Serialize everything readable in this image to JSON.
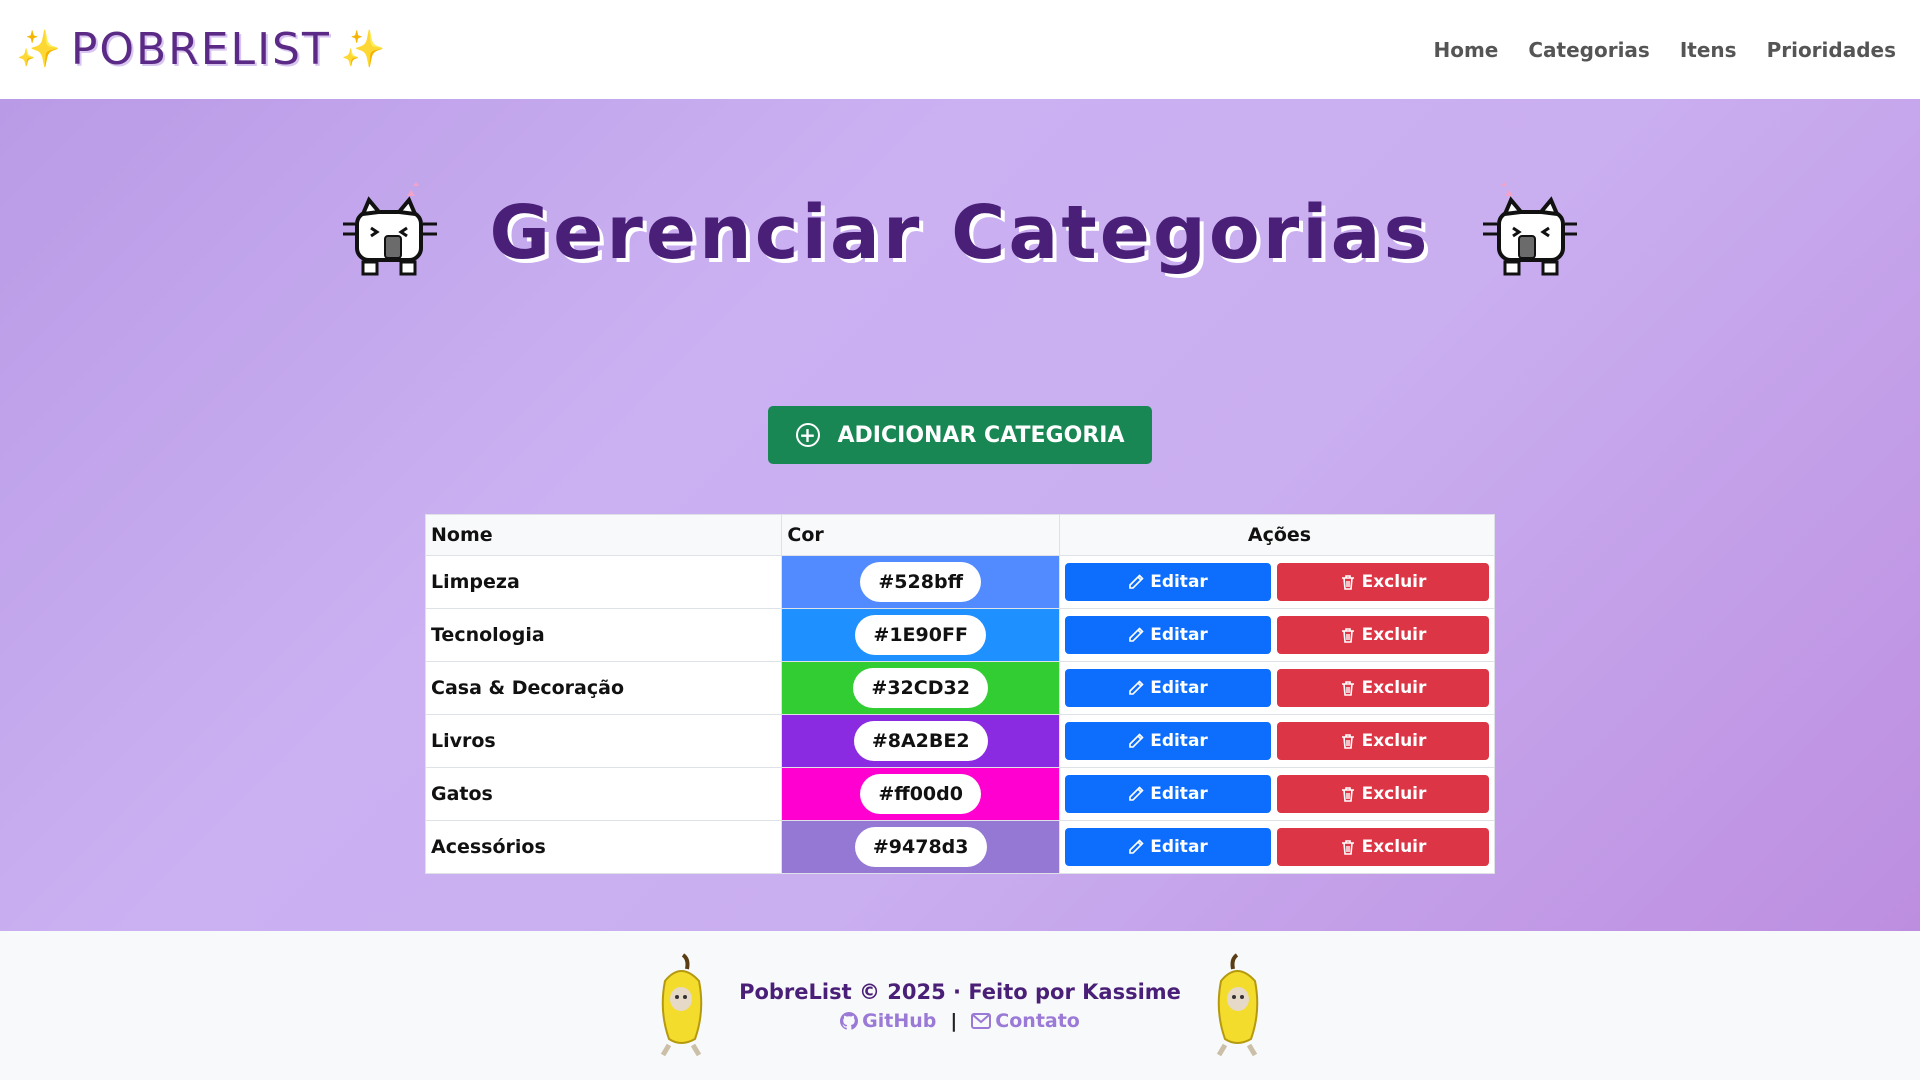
{
  "navbar": {
    "brand": "POBRELIST",
    "sparkle": "✨",
    "links": [
      "Home",
      "Categorias",
      "Itens",
      "Prioridades"
    ]
  },
  "main": {
    "title": "Gerenciar Categorias",
    "add_button": "ADICIONAR CATEGORIA"
  },
  "table": {
    "headers": [
      "Nome",
      "Cor",
      "Ações"
    ],
    "edit_label": "Editar",
    "delete_label": "Excluir",
    "rows": [
      {
        "name": "Limpeza",
        "color": "#528bff"
      },
      {
        "name": "Tecnologia",
        "color": "#1E90FF"
      },
      {
        "name": "Casa & Decoração",
        "color": "#32CD32"
      },
      {
        "name": "Livros",
        "color": "#8A2BE2"
      },
      {
        "name": "Gatos",
        "color": "#ff00d0"
      },
      {
        "name": "Acessórios",
        "color": "#9478d3"
      }
    ]
  },
  "footer": {
    "text": "PobreList © 2025 · Feito por Kassime",
    "github": "GitHub",
    "separator": "|",
    "contact": "Contato"
  },
  "colors": {
    "accent": "#4a1f78",
    "add": "#198754",
    "edit": "#0d6efd",
    "delete": "#dc3545"
  }
}
